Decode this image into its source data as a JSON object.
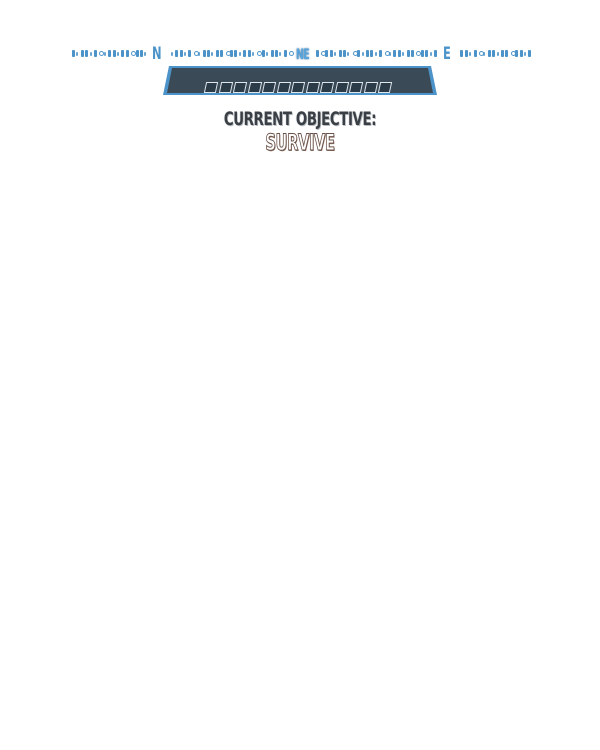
{
  "compass": {
    "north_label": "N",
    "northeast_label": "NE",
    "east_label": "E",
    "accent_color": "#4b93c9"
  },
  "status_bar": {
    "frame_color": "#4b93c9",
    "fill_color": "#3a4a57",
    "segment_count": 13,
    "segment_color": "#2c3b48"
  },
  "objective": {
    "heading": "CURRENT OBJECTIVE:",
    "value": "SURVIVE"
  }
}
